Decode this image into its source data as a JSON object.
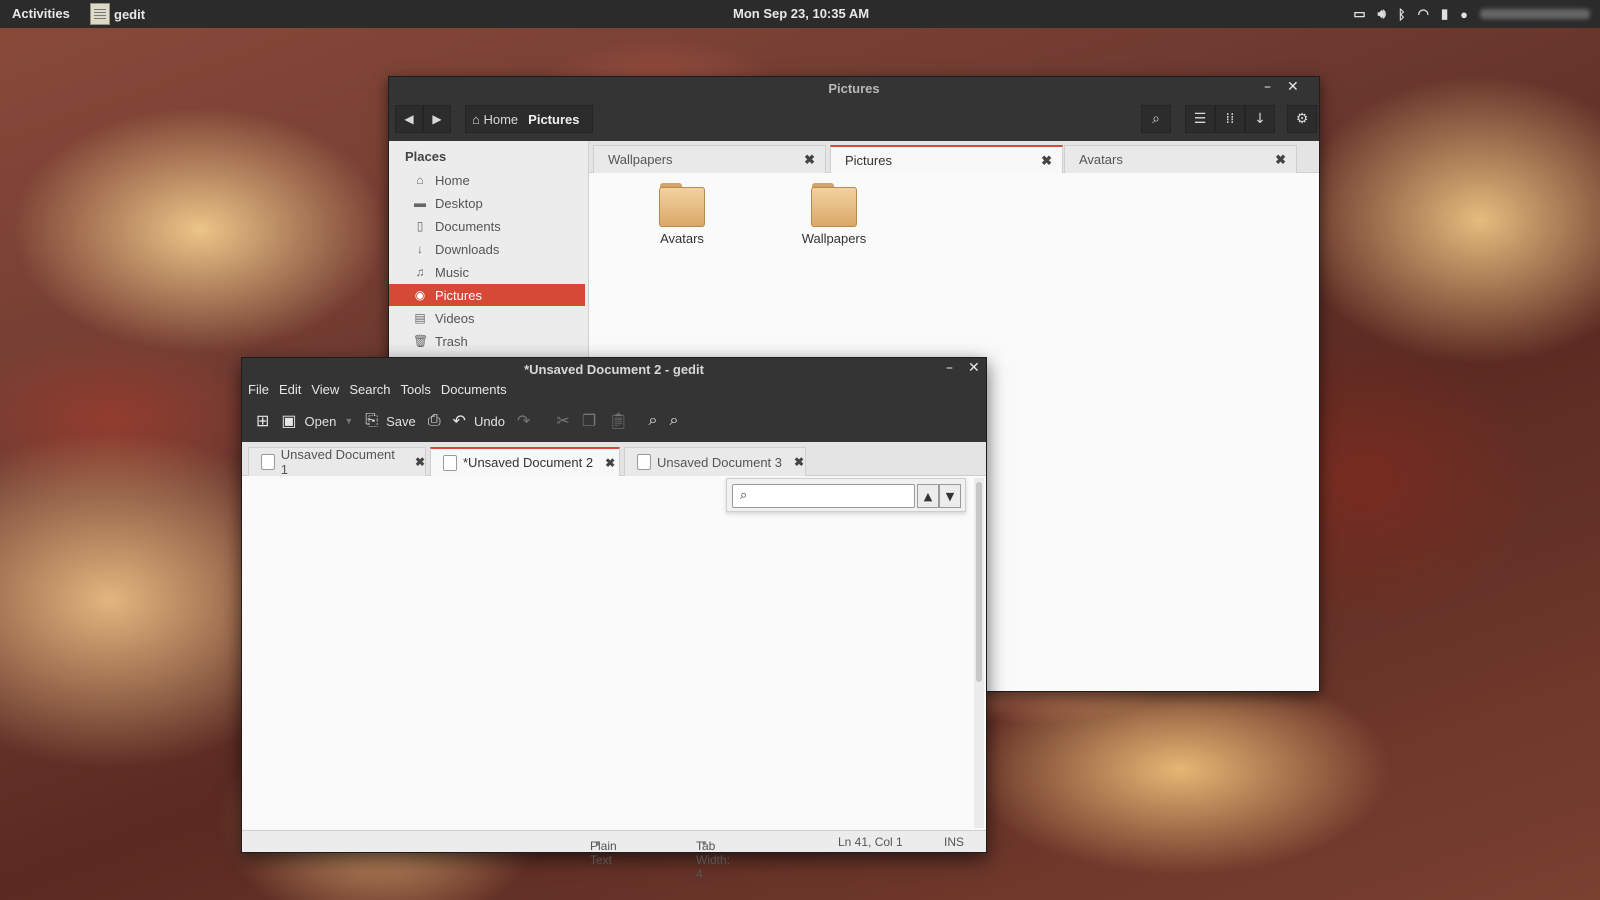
{
  "topbar": {
    "activities": "Activities",
    "app_name": "gedit",
    "clock": "Mon Sep 23, 10:35 AM"
  },
  "tray_icons": [
    "screen-icon",
    "volume-icon",
    "bluetooth-icon",
    "wifi-icon",
    "battery-icon",
    "chat-icon"
  ],
  "file_manager": {
    "title": "Pictures",
    "path": {
      "home": "Home",
      "current": "Pictures"
    },
    "places_heading": "Places",
    "places": [
      {
        "label": "Home",
        "icon": "home-icon",
        "active": false
      },
      {
        "label": "Desktop",
        "icon": "desktop-icon",
        "active": false
      },
      {
        "label": "Documents",
        "icon": "document-icon",
        "active": false
      },
      {
        "label": "Downloads",
        "icon": "download-icon",
        "active": false
      },
      {
        "label": "Music",
        "icon": "music-icon",
        "active": false
      },
      {
        "label": "Pictures",
        "icon": "camera-icon",
        "active": true
      },
      {
        "label": "Videos",
        "icon": "film-icon",
        "active": false
      },
      {
        "label": "Trash",
        "icon": "trash-icon",
        "active": false
      }
    ],
    "tabs": [
      {
        "label": "Wallpapers",
        "active": false
      },
      {
        "label": "Pictures",
        "active": true
      },
      {
        "label": "Avatars",
        "active": false
      }
    ],
    "folders": [
      "Avatars",
      "Wallpapers"
    ],
    "accent_color": "#d64937"
  },
  "gedit": {
    "title": "*Unsaved Document 2 - gedit",
    "menu": [
      "File",
      "Edit",
      "View",
      "Search",
      "Tools",
      "Documents"
    ],
    "toolbar": {
      "open": "Open",
      "save": "Save",
      "undo": "Undo"
    },
    "tabs": [
      {
        "label": "Unsaved Document 1",
        "active": false
      },
      {
        "label": "*Unsaved Document 2",
        "active": true
      },
      {
        "label": "Unsaved Document 3",
        "active": false
      }
    ],
    "search": {
      "value": "",
      "placeholder": ""
    },
    "status": {
      "language": "Plain Text",
      "tab_width": "Tab Width: 4",
      "position": "Ln 41, Col 1",
      "mode": "INS"
    }
  }
}
